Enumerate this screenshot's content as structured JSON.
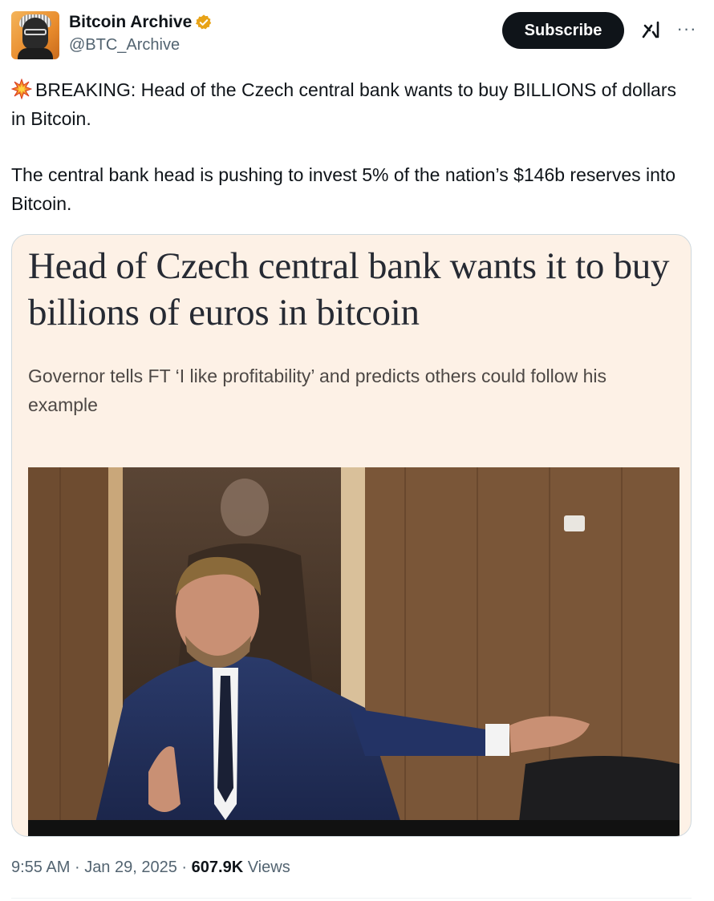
{
  "author": {
    "display_name": "Bitcoin Archive",
    "handle": "@BTC_Archive",
    "verified_badge_color": "#e8a317"
  },
  "header_actions": {
    "subscribe_label": "Subscribe",
    "grok_icon": "grok-icon",
    "more_icon": "more-icon",
    "more_glyph": "···"
  },
  "tweet": {
    "line1_emoji": "collision-emoji",
    "line1": "BREAKING: Head of the Czech central bank wants to buy BILLIONS of dollars in Bitcoin.",
    "line2": "The central bank head is pushing to invest 5% of the nation’s $146b reserves into Bitcoin."
  },
  "media_card": {
    "headline": "Head of Czech central bank wants it to buy billions of euros in bitcoin",
    "standfirst": "Governor tells FT ‘I like profitability’ and predicts others could follow his example",
    "background_color": "#fdf1e6",
    "photo_description_icon": "article-photo"
  },
  "meta": {
    "time": "9:55 AM",
    "separator": "·",
    "date": "Jan 29, 2025",
    "views_count": "607.9K",
    "views_label": "Views"
  }
}
